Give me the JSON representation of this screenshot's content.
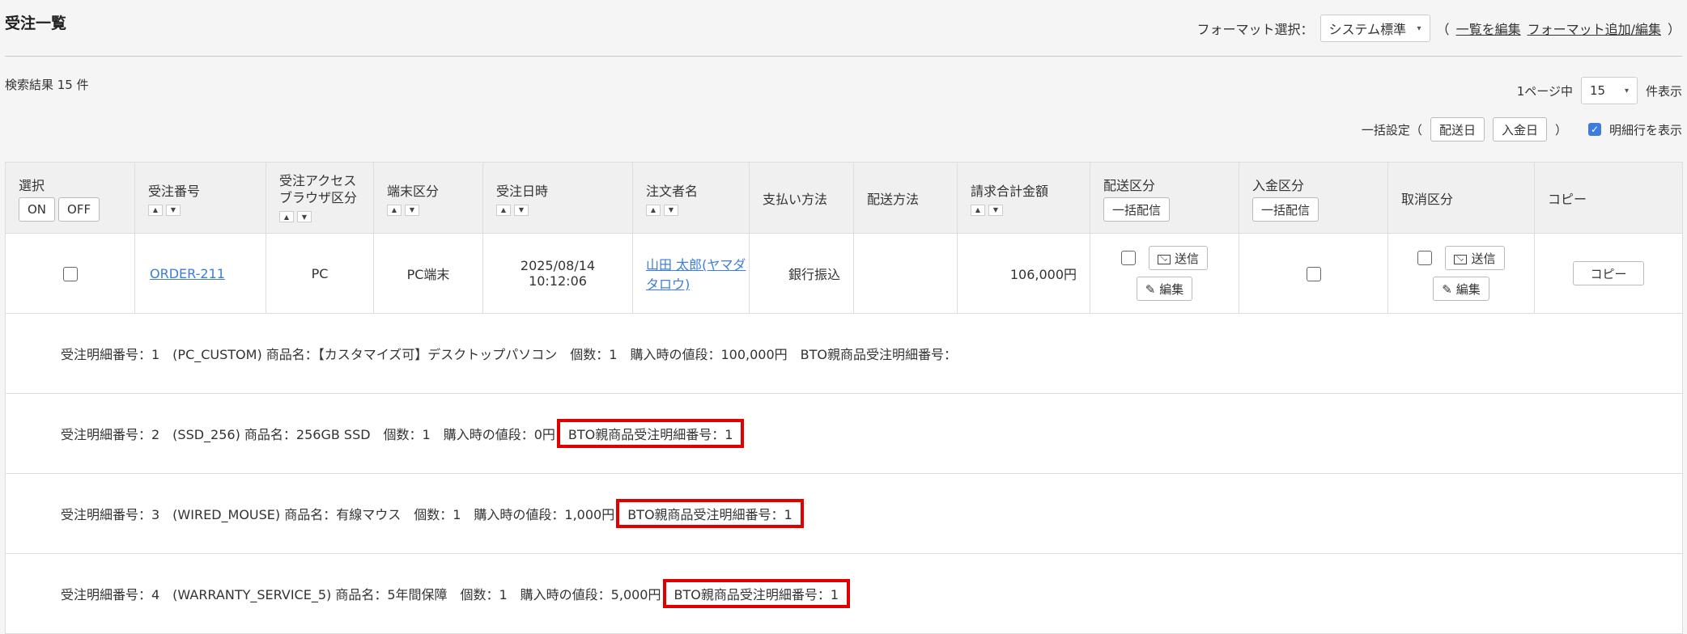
{
  "page": {
    "title": "受注一覧"
  },
  "format": {
    "label": "フォーマット選択：",
    "selected": "システム標準",
    "paren_open": "（",
    "edit_list": "一覧を編集",
    "add_edit": "フォーマット追加/編集",
    "paren_close": "）"
  },
  "results": {
    "count_text": "検索結果 15 件"
  },
  "pagination": {
    "prefix": "1ページ中",
    "per_page": "15",
    "suffix": "件表示"
  },
  "bulk": {
    "label": "一括設定（",
    "ship_date": "配送日",
    "pay_date": "入金日",
    "close": "）",
    "show_detail": "明細行を表示"
  },
  "columns": {
    "select": "選択",
    "on": "ON",
    "off": "OFF",
    "order_no": "受注番号",
    "access_browser": "受注アクセス\nブラウザ区分",
    "device": "端末区分",
    "order_date": "受注日時",
    "customer": "注文者名",
    "payment": "支払い方法",
    "delivery": "配送方法",
    "total": "請求合計金額",
    "ship_status": "配送区分",
    "pay_status": "入金区分",
    "cancel_status": "取消区分",
    "copy": "コピー",
    "bulk_send": "一括配信"
  },
  "order": {
    "order_no": "ORDER-211",
    "access_browser": "PC",
    "device": "PC端末",
    "date": "2025/08/14",
    "time": "10:12:06",
    "customer": "山田 太郎(ヤマダ タロウ)",
    "payment": "銀行振込",
    "delivery": "",
    "total": "106,000円",
    "send_label": "送信",
    "edit_label": "編集",
    "copy_label": "コピー"
  },
  "details": [
    {
      "text": "受注明細番号：1　(PC_CUSTOM) 商品名：【カスタマイズ可】デスクトップパソコン　個数：1　購入時の値段：100,000円　BTO親商品受注明細番号：",
      "highlight": ""
    },
    {
      "text": "受注明細番号：2　(SSD_256) 商品名：256GB SSD　個数：1　購入時の値段：0円",
      "highlight": "BTO親商品受注明細番号：1"
    },
    {
      "text": "受注明細番号：3　(WIRED_MOUSE) 商品名：有線マウス　個数：1　購入時の値段：1,000円",
      "highlight": "BTO親商品受注明細番号：1"
    },
    {
      "text": "受注明細番号：4　(WARRANTY_SERVICE_5) 商品名：5年間保障　個数：1　購入時の値段：5,000円",
      "highlight": "BTO親商品受注明細番号：1"
    }
  ],
  "colors": {
    "link": "#3b7dd8",
    "highlight_border": "#e00000"
  }
}
